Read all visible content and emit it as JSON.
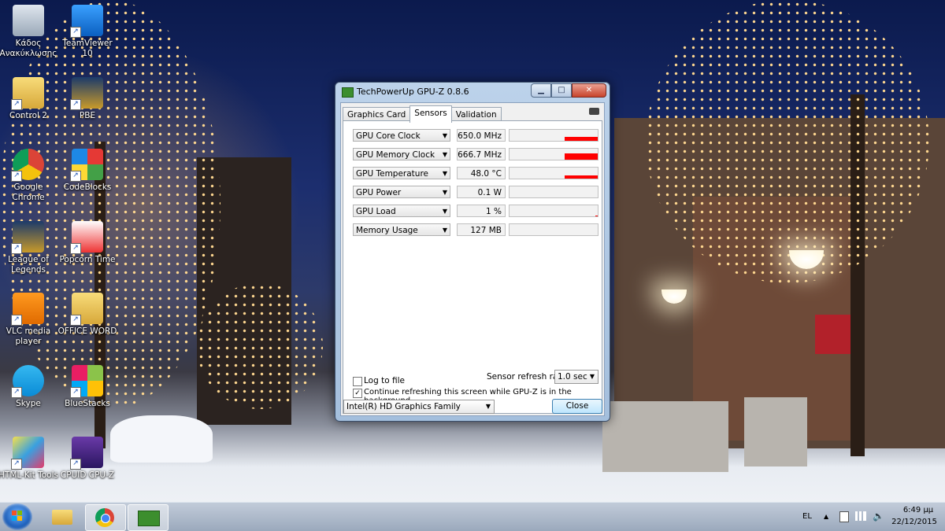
{
  "desktop": {
    "icons": [
      {
        "label": "Κάδος Ανακύκλωσης",
        "icon": "recycle-bin-icon"
      },
      {
        "label": "TeamViewer 10",
        "icon": "teamviewer-icon"
      },
      {
        "label": "Control 2",
        "icon": "folder-icon"
      },
      {
        "label": "PBE",
        "icon": "pbe-icon"
      },
      {
        "label": "Google Chrome",
        "icon": "chrome-icon"
      },
      {
        "label": "CodeBlocks",
        "icon": "codeblocks-icon"
      },
      {
        "label": "League of Legends",
        "icon": "league-of-legends-icon"
      },
      {
        "label": "Popcorn Time",
        "icon": "popcorn-time-icon"
      },
      {
        "label": "VLC media player",
        "icon": "vlc-icon"
      },
      {
        "label": "OFFICE WORD",
        "icon": "folder-icon"
      },
      {
        "label": "Skype",
        "icon": "skype-icon"
      },
      {
        "label": "BlueStacks",
        "icon": "bluestacks-icon"
      },
      {
        "label": "HTML-Kit Tools",
        "icon": "html-kit-icon"
      },
      {
        "label": "CPUID CPU-Z",
        "icon": "cpuz-icon"
      }
    ]
  },
  "window": {
    "title": "TechPowerUp GPU-Z 0.8.6",
    "minimize": "▁",
    "maximize": "□",
    "close": "✕",
    "tabs": [
      {
        "label": "Graphics Card",
        "active": false
      },
      {
        "label": "Sensors",
        "active": true
      },
      {
        "label": "Validation",
        "active": false
      }
    ],
    "sensors": [
      {
        "name": "GPU Core Clock",
        "value": "650.0 MHz",
        "level": 0.38
      },
      {
        "name": "GPU Memory Clock",
        "value": "666.7 MHz",
        "level": 0.55
      },
      {
        "name": "GPU Temperature",
        "value": "48.0 °C",
        "level": 0.3
      },
      {
        "name": "GPU Power",
        "value": "0.1 W",
        "level": 0
      },
      {
        "name": "GPU Load",
        "value": "1 %",
        "level": 0.05
      },
      {
        "name": "Memory Usage",
        "value": "127 MB",
        "level": 0
      }
    ],
    "log_to_file": {
      "label": "Log to file",
      "checked": false
    },
    "refresh_rate": {
      "label": "Sensor refresh rate:",
      "value": "1.0 sec"
    },
    "continue_refreshing": {
      "label": "Continue refreshing this screen while GPU-Z is in the background",
      "checked": true
    },
    "gpu_select": "Intel(R) HD Graphics Family",
    "close_button": "Close"
  },
  "taskbar": {
    "language": "EL",
    "time": "6:49 μμ",
    "date": "22/12/2015",
    "tray_expand": "▲"
  },
  "colors": {
    "graph_fill": "#ff0000",
    "window_frame": "#a4bfdd"
  }
}
